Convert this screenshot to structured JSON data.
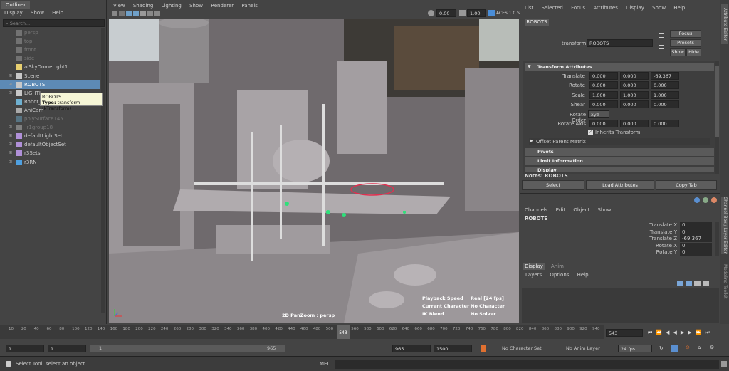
{
  "outliner": {
    "tab": "Outliner",
    "menu": [
      "Display",
      "Show",
      "Help"
    ],
    "search_placeholder": "Search...",
    "items": [
      {
        "label": "persp",
        "dim": true,
        "type": "camera"
      },
      {
        "label": "top",
        "dim": true,
        "type": "camera"
      },
      {
        "label": "front",
        "dim": true,
        "type": "camera"
      },
      {
        "label": "side",
        "dim": true,
        "type": "camera"
      },
      {
        "label": "aiSkyDomeLight1",
        "dim": false,
        "type": "light"
      },
      {
        "label": "Scene",
        "dim": false,
        "type": "group"
      },
      {
        "label": "ROBOTS",
        "dim": false,
        "type": "group",
        "selected": true
      },
      {
        "label": "LIGHTI",
        "dim": false,
        "type": "group"
      },
      {
        "label": "Robot_H",
        "dim": false,
        "type": "mesh"
      },
      {
        "label": "AniCam",
        "dim": false,
        "type": "camera"
      },
      {
        "label": "polySurface145",
        "dim": true,
        "type": "mesh"
      },
      {
        "label": "_r1group18",
        "dim": true,
        "type": "group"
      },
      {
        "label": "defaultLightSet",
        "dim": false,
        "type": "set"
      },
      {
        "label": "defaultObjectSet",
        "dim": false,
        "type": "set"
      },
      {
        "label": "r3Sets",
        "dim": false,
        "type": "set"
      },
      {
        "label": "r3RN",
        "dim": false,
        "type": "ref"
      }
    ],
    "tooltip": {
      "name": "ROBOTS",
      "type_label": "Type:",
      "type_value": "transform (kTransform)"
    }
  },
  "viewport": {
    "menu": [
      "View",
      "Shading",
      "Lighting",
      "Show",
      "Renderer",
      "Panels"
    ],
    "value_a": "0.00",
    "value_b": "1.00",
    "color_space": "ACES 1.0 SDR-",
    "hud_label": "2D PanZoom : persp",
    "hud_stats": [
      [
        "Playback Speed",
        "Real [24 fps]"
      ],
      [
        "Current Character",
        "No Character"
      ],
      [
        "IK Blend",
        "No Solver"
      ]
    ]
  },
  "attribute_editor": {
    "menu": [
      "List",
      "Selected",
      "Focus",
      "Attributes",
      "Display",
      "Show",
      "Help"
    ],
    "tab": "ROBOTS",
    "transform_label": "transform:",
    "transform_value": "ROBOTS",
    "buttons": {
      "focus": "Focus",
      "presets": "Presets",
      "show": "Show",
      "hide": "Hide"
    },
    "section_transform": "Transform Attributes",
    "attrs": [
      {
        "label": "Translate",
        "v": [
          "0.000",
          "0.000",
          "-69.367"
        ]
      },
      {
        "label": "Rotate",
        "v": [
          "0.000",
          "0.000",
          "0.000"
        ]
      },
      {
        "label": "Scale",
        "v": [
          "1.000",
          "1.000",
          "1.000"
        ]
      },
      {
        "label": "Shear",
        "v": [
          "0.000",
          "0.000",
          "0.000"
        ]
      }
    ],
    "rotate_order_label": "Rotate Order",
    "rotate_order_value": "xyz",
    "rotate_axis_label": "Rotate Axis",
    "rotate_axis": [
      "0.000",
      "0.000",
      "0.000"
    ],
    "inherits": "Inherits Transform",
    "offset_parent": "Offset Parent Matrix",
    "sections": [
      "Pivots",
      "Limit Information",
      "Display"
    ],
    "notes": "Notes: ROBOTS",
    "bottom_buttons": {
      "select": "Select",
      "load": "Load Attributes",
      "copy": "Copy Tab"
    },
    "side_tab": "Attribute Editor"
  },
  "channel_box": {
    "menu": [
      "Channels",
      "Edit",
      "Object",
      "Show"
    ],
    "object": "ROBOTS",
    "channels": [
      {
        "label": "Translate X",
        "value": "0"
      },
      {
        "label": "Translate Y",
        "value": "0"
      },
      {
        "label": "Translate Z",
        "value": "-69.367"
      },
      {
        "label": "Rotate X",
        "value": "0"
      },
      {
        "label": "Rotate Y",
        "value": "0"
      }
    ],
    "side_tab": "Channel Box / Layer Editor",
    "side_tab2": "Modeling Toolkit"
  },
  "layer_editor": {
    "tabs": [
      "Display",
      "Anim"
    ],
    "menu": [
      "Layers",
      "Options",
      "Help"
    ]
  },
  "timeline": {
    "ticks": [
      "10",
      "20",
      "40",
      "60",
      "80",
      "100",
      "120",
      "140",
      "160",
      "180",
      "200",
      "220",
      "240",
      "260",
      "280",
      "300",
      "320",
      "340",
      "360",
      "380",
      "400",
      "420",
      "440",
      "460",
      "480",
      "500",
      "520",
      "560",
      "580",
      "600",
      "620",
      "640",
      "660",
      "680",
      "700",
      "720",
      "740",
      "760",
      "780",
      "800",
      "820",
      "840",
      "860",
      "880",
      "900",
      "920",
      "940"
    ],
    "current": "543",
    "current_field": "543"
  },
  "range": {
    "start": "1",
    "start2": "1",
    "slider_start": "1",
    "slider_end": "965",
    "end": "965",
    "end2": "1500",
    "character": "No Character Set",
    "anim_layer": "No Anim Layer",
    "fps": "24 fps"
  },
  "status": {
    "help": "Select Tool: select an object",
    "mel": "MEL"
  }
}
